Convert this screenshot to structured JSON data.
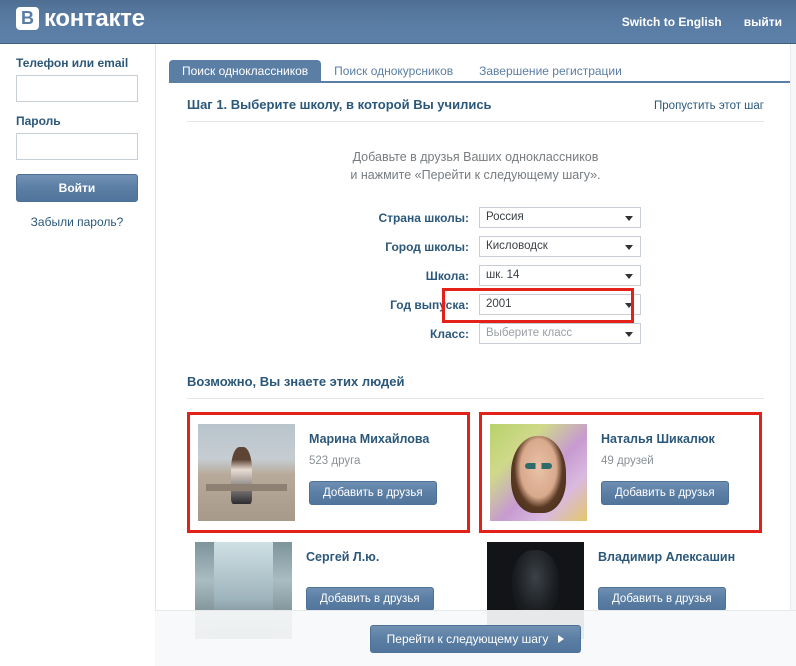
{
  "header": {
    "logo_badge": "В",
    "logo_word": "контакте",
    "switch_language": "Switch to English",
    "logout": "выйти"
  },
  "sidebar": {
    "login_label": "Телефон или email",
    "login_value": "",
    "login_placeholder": "",
    "password_label": "Пароль",
    "password_value": "",
    "password_placeholder": "",
    "login_button": "Войти",
    "forgot_password": "Забыли пароль?"
  },
  "tabs": [
    {
      "label": "Поиск одноклассников",
      "active": true
    },
    {
      "label": "Поиск однокурсников",
      "active": false
    },
    {
      "label": "Завершение регистрации",
      "active": false
    }
  ],
  "step": {
    "title": "Шаг 1. Выберите школу, в которой Вы учились",
    "skip_link": "Пропустить этот шаг",
    "intro_line1": "Добавьте в друзья Ваших одноклассников",
    "intro_line2": "и нажмите «Перейти к следующему шагу»."
  },
  "form": {
    "fields": [
      {
        "label": "Страна школы:",
        "value": "Россия",
        "is_placeholder": false,
        "highlighted": false
      },
      {
        "label": "Город школы:",
        "value": "Кисловодск",
        "is_placeholder": false,
        "highlighted": false
      },
      {
        "label": "Школа:",
        "value": "шк. 14",
        "is_placeholder": false,
        "highlighted": false
      },
      {
        "label": "Год выпуска:",
        "value": "2001",
        "is_placeholder": false,
        "highlighted": true
      },
      {
        "label": "Класс:",
        "value": "Выберите класс",
        "is_placeholder": true,
        "highlighted": false
      }
    ],
    "highlight_color": "#e32119"
  },
  "people": {
    "heading": "Возможно, Вы знаете этих людей",
    "add_friend_label": "Добавить в друзья",
    "cards": [
      {
        "name": "Марина Михайлова",
        "friends": "523 друга",
        "avatar": "photo-woman-on-bench",
        "highlighted": true,
        "partial": false
      },
      {
        "name": "Наталья Шикалюк",
        "friends": "49 друзей",
        "avatar": "photo-doll-portrait",
        "highlighted": true,
        "partial": false
      },
      {
        "name": "Сергей Л.ю.",
        "friends": "",
        "avatar": "photo-blue-waterfall",
        "highlighted": false,
        "partial": true
      },
      {
        "name": "Владимир Алексашин",
        "friends": "",
        "avatar": "photo-dark",
        "highlighted": false,
        "partial": true
      }
    ]
  },
  "footer": {
    "next_step_label": "Перейти к следующему шагу"
  },
  "colors": {
    "brand_blue": "#5b7ea4",
    "link_blue": "#2b587a",
    "highlight_red": "#e32119",
    "muted_text": "#8a9096"
  }
}
